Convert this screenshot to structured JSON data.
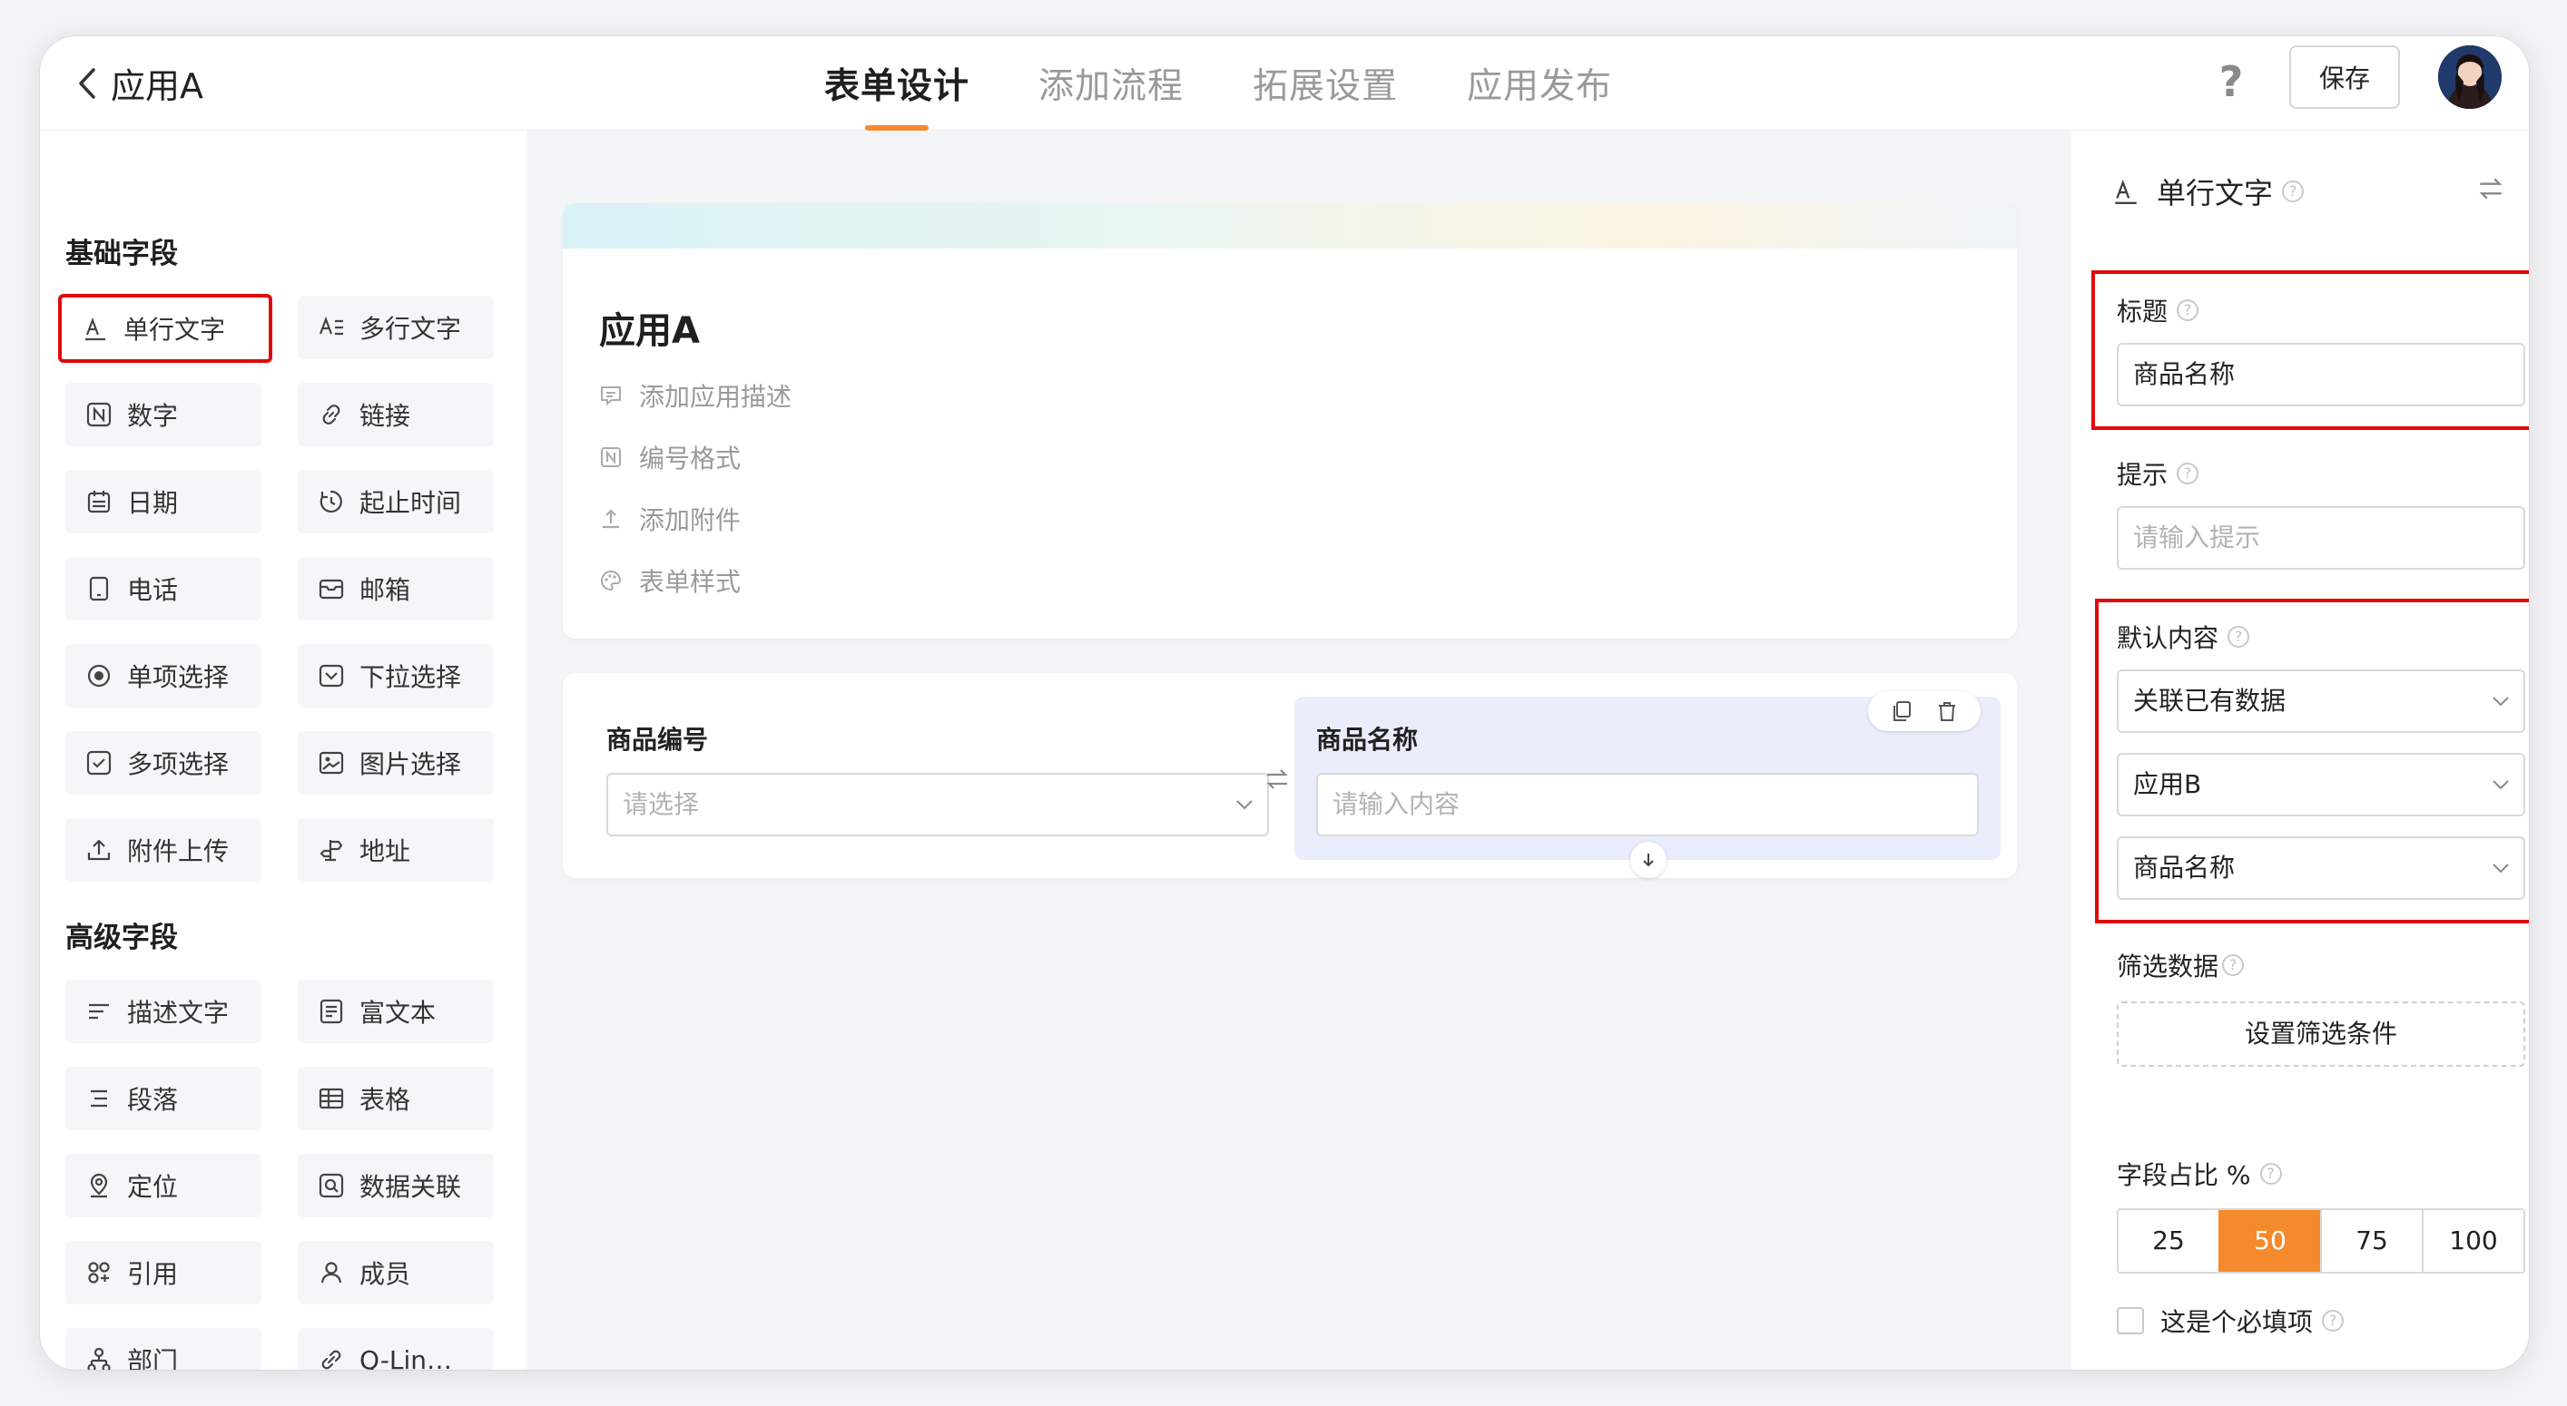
{
  "header": {
    "app_title": "应用A",
    "tabs": [
      {
        "label": "表单设计",
        "active": true
      },
      {
        "label": "添加流程",
        "active": false
      },
      {
        "label": "拓展设置",
        "active": false
      },
      {
        "label": "应用发布",
        "active": false
      }
    ],
    "help_label": "?",
    "save_label": "保存"
  },
  "sidebar": {
    "basic_title": "基础字段",
    "basic_fields": [
      {
        "label": "单行文字",
        "icon": "single-line-text-icon"
      },
      {
        "label": "多行文字",
        "icon": "multi-line-text-icon"
      },
      {
        "label": "数字",
        "icon": "number-icon"
      },
      {
        "label": "链接",
        "icon": "link-icon"
      },
      {
        "label": "日期",
        "icon": "calendar-icon"
      },
      {
        "label": "起止时间",
        "icon": "time-range-icon"
      },
      {
        "label": "电话",
        "icon": "phone-icon"
      },
      {
        "label": "邮箱",
        "icon": "mail-icon"
      },
      {
        "label": "单项选择",
        "icon": "radio-icon"
      },
      {
        "label": "下拉选择",
        "icon": "dropdown-icon"
      },
      {
        "label": "多项选择",
        "icon": "checkbox-icon"
      },
      {
        "label": "图片选择",
        "icon": "image-icon"
      },
      {
        "label": "附件上传",
        "icon": "upload-icon"
      },
      {
        "label": "地址",
        "icon": "address-icon"
      }
    ],
    "advanced_title": "高级字段",
    "advanced_fields": [
      {
        "label": "描述文字",
        "icon": "description-icon"
      },
      {
        "label": "富文本",
        "icon": "rich-text-icon"
      },
      {
        "label": "段落",
        "icon": "paragraph-icon"
      },
      {
        "label": "表格",
        "icon": "table-icon"
      },
      {
        "label": "定位",
        "icon": "location-icon"
      },
      {
        "label": "数据关联",
        "icon": "data-link-icon"
      },
      {
        "label": "引用",
        "icon": "reference-icon"
      },
      {
        "label": "成员",
        "icon": "member-icon"
      },
      {
        "label": "部门",
        "icon": "department-icon"
      },
      {
        "label": "Q-Lin…",
        "icon": "q-link-icon"
      }
    ]
  },
  "form": {
    "title": "应用A",
    "meta": [
      {
        "label": "添加应用描述",
        "icon": "comment-icon"
      },
      {
        "label": "编号格式",
        "icon": "number-format-icon"
      },
      {
        "label": "添加附件",
        "icon": "attachment-upload-icon"
      },
      {
        "label": "表单样式",
        "icon": "palette-icon"
      }
    ],
    "field1": {
      "label": "商品编号",
      "placeholder": "请选择"
    },
    "field2": {
      "label": "商品名称",
      "placeholder": "请输入内容"
    }
  },
  "panel": {
    "header": "单行文字",
    "title_label": "标题",
    "title_value": "商品名称",
    "hint_label": "提示",
    "hint_placeholder": "请输入提示",
    "default_label": "默认内容",
    "default_source": "关联已有数据",
    "default_app": "应用B",
    "default_field": "商品名称",
    "filter_label": "筛选数据",
    "filter_button": "设置筛选条件",
    "ratio_label": "字段占比 %",
    "ratio_options": [
      "25",
      "50",
      "75",
      "100"
    ],
    "ratio_selected": "50",
    "required_label": "这是个必填项"
  },
  "colors": {
    "accent": "#f58a2c",
    "highlight": "#e00a0a",
    "selected_field_bg": "#eaedfb"
  }
}
